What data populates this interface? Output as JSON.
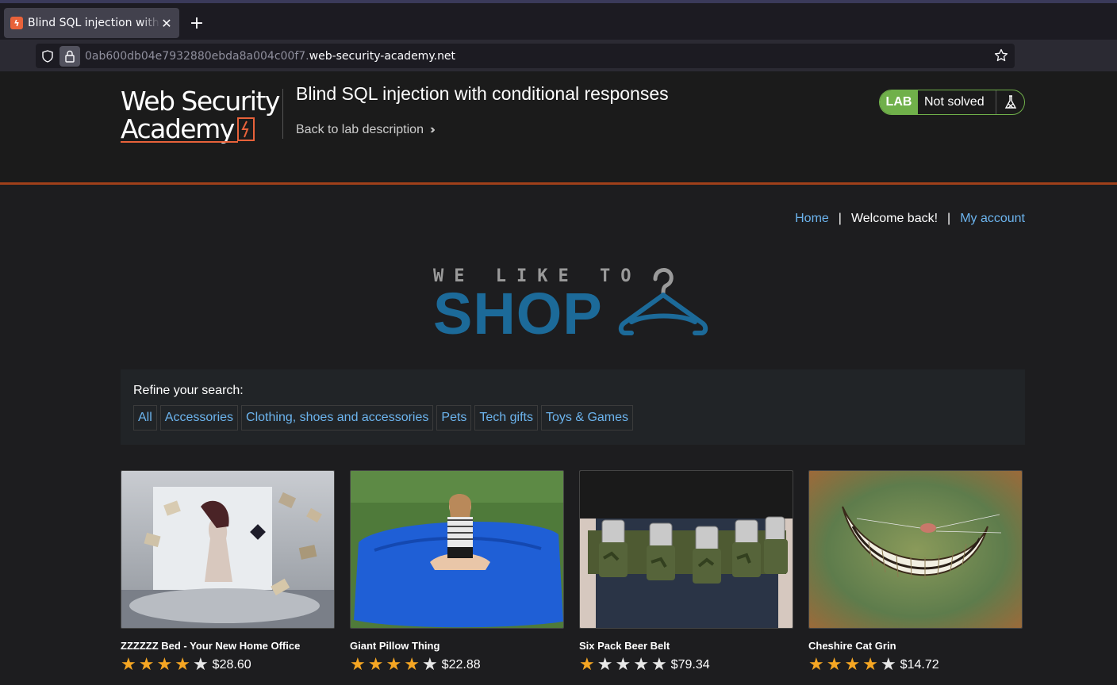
{
  "browser": {
    "tab_title": "Blind SQL injection with conditional responses",
    "new_tab_label": "+",
    "url_prefix": "0ab600db04e7932880ebda8a004c00f7.",
    "url_host": "web-security-academy.net"
  },
  "header": {
    "logo_line1": "Web Security",
    "logo_line2": "Academy",
    "lab_title": "Blind SQL injection with conditional responses",
    "back_link": "Back to lab description",
    "status_label": "LAB",
    "status_text": "Not solved",
    "accent_color": "#e8623a",
    "status_color": "#70b04a"
  },
  "nav": {
    "home": "Home",
    "sep1": "|",
    "welcome": "Welcome back!",
    "sep2": "|",
    "account": "My account"
  },
  "shop_logo": {
    "tagline": "WE LIKE TO",
    "word": "SHOP"
  },
  "filter": {
    "label": "Refine your search:",
    "categories": [
      "All",
      "Accessories",
      "Clothing, shoes and accessories",
      "Pets",
      "Tech gifts",
      "Toys & Games"
    ]
  },
  "products": [
    {
      "name": "ZZZZZZ Bed - Your New Home Office",
      "rating": 4,
      "price": "$28.60"
    },
    {
      "name": "Giant Pillow Thing",
      "rating": 4,
      "price": "$22.88"
    },
    {
      "name": "Six Pack Beer Belt",
      "rating": 1,
      "price": "$79.34"
    },
    {
      "name": "Cheshire Cat Grin",
      "rating": 4,
      "price": "$14.72"
    }
  ]
}
